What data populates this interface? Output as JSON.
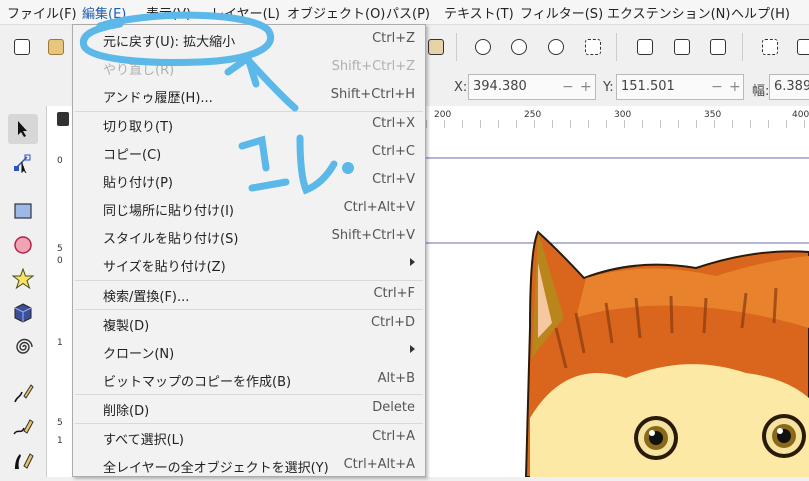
{
  "menubar": {
    "items": [
      "ファイル(F)",
      "編集(E)",
      "表示(V)",
      "レイヤー(L)",
      "オブジェクト(O)",
      "パス(P)",
      "テキスト(T)",
      "フィルター(S)",
      "エクステンション(N)",
      "ヘルプ(H)"
    ]
  },
  "controls": {
    "x_label": "X:",
    "x_value": "394.380",
    "y_label": "Y:",
    "y_value": "151.501",
    "w_label": "幅:",
    "w_value": "6.389",
    "minus": "−",
    "plus": "+"
  },
  "hruler": {
    "ticks": [
      "200",
      "250",
      "300",
      "350",
      "400"
    ]
  },
  "vruler": {
    "ticks": [
      "0",
      "5",
      "0",
      "1",
      "5",
      "1"
    ]
  },
  "edit_menu": {
    "items": [
      {
        "label": "元に戻す(U): 拡大縮小",
        "shortcut": "Ctrl+Z",
        "disabled": false
      },
      {
        "label": "やり直し(R)",
        "shortcut": "Shift+Ctrl+Z",
        "disabled": true
      },
      {
        "label": "アンドゥ履歴(H)...",
        "shortcut": "Shift+Ctrl+H",
        "disabled": false
      },
      {
        "label": "切り取り(T)",
        "shortcut": "Ctrl+X",
        "disabled": false
      },
      {
        "label": "コピー(C)",
        "shortcut": "Ctrl+C",
        "disabled": false
      },
      {
        "label": "貼り付け(P)",
        "shortcut": "Ctrl+V",
        "disabled": false
      },
      {
        "label": "同じ場所に貼り付け(I)",
        "shortcut": "Ctrl+Alt+V",
        "disabled": false
      },
      {
        "label": "スタイルを貼り付け(S)",
        "shortcut": "Shift+Ctrl+V",
        "disabled": false
      },
      {
        "label": "サイズを貼り付け(Z)",
        "shortcut": "",
        "disabled": false,
        "submenu": true
      },
      {
        "label": "検索/置換(F)...",
        "shortcut": "Ctrl+F",
        "disabled": false
      },
      {
        "label": "複製(D)",
        "shortcut": "Ctrl+D",
        "disabled": false
      },
      {
        "label": "クローン(N)",
        "shortcut": "",
        "disabled": false,
        "submenu": true
      },
      {
        "label": "ビットマップのコピーを作成(B)",
        "shortcut": "Alt+B",
        "disabled": false
      },
      {
        "label": "削除(D)",
        "shortcut": "Delete",
        "disabled": false
      },
      {
        "label": "すべて選択(L)",
        "shortcut": "Ctrl+A",
        "disabled": false
      },
      {
        "label": "全レイヤーの全オブジェクトを選択(Y)",
        "shortcut": "Ctrl+Alt+A",
        "disabled": false
      }
    ]
  },
  "annotation": {
    "text": "コレ",
    "color": "#5bb8e8"
  },
  "colors": {
    "highlight_menu": "#1c5db0",
    "cat_orange": "#d9661c",
    "cat_cream": "#fde9a6"
  }
}
